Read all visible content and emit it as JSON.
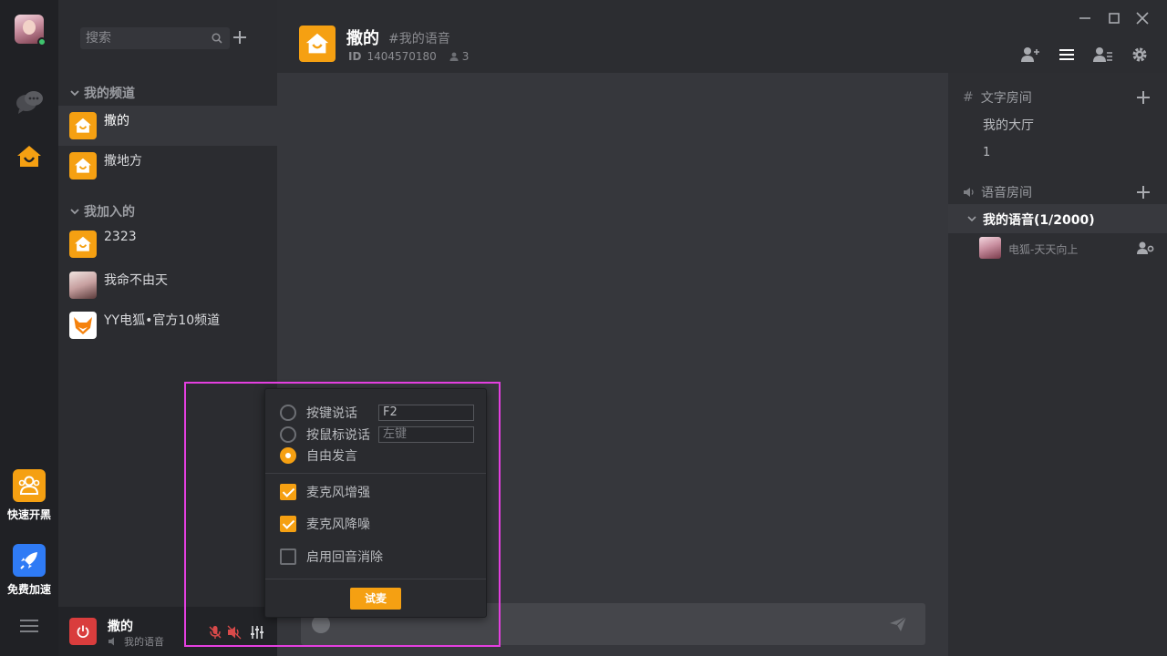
{
  "search": {
    "placeholder": "搜索"
  },
  "channels": {
    "my_section": "我的频道",
    "my": [
      {
        "name": "撒的"
      },
      {
        "name": "撒地方"
      }
    ],
    "joined_section": "我加入的",
    "joined": [
      {
        "name": "2323"
      },
      {
        "name": "我命不由天"
      },
      {
        "name": "YY电狐•官方10频道"
      }
    ]
  },
  "rail": {
    "quick_label": "快速开黑",
    "boost_label": "免费加速"
  },
  "header": {
    "title": "撒的",
    "tag": "#我的语音",
    "id_label": "ID",
    "id_value": "1404570180",
    "member_count": "3"
  },
  "right_panel": {
    "text_rooms": "文字房间",
    "text_items": [
      "我的大厅",
      "1"
    ],
    "voice_rooms": "语音房间",
    "voice_channel": "我的语音(1/2000)",
    "voice_user": "电狐-天天向上"
  },
  "userbar": {
    "name": "撒的",
    "sub": "我的语音"
  },
  "voice_popup": {
    "opt_key": "按键说话",
    "opt_key_value": "F2",
    "opt_mouse": "按鼠标说话",
    "opt_mouse_value": "左键",
    "opt_free": "自由发言",
    "mic_boost": "麦克风增强",
    "mic_denoise": "麦克风降噪",
    "echo_cancel": "启用回音消除",
    "try_button": "试麦"
  },
  "colors": {
    "accent": "#f5a012",
    "power": "#d93d3d",
    "highlight": "#e43fe0"
  }
}
